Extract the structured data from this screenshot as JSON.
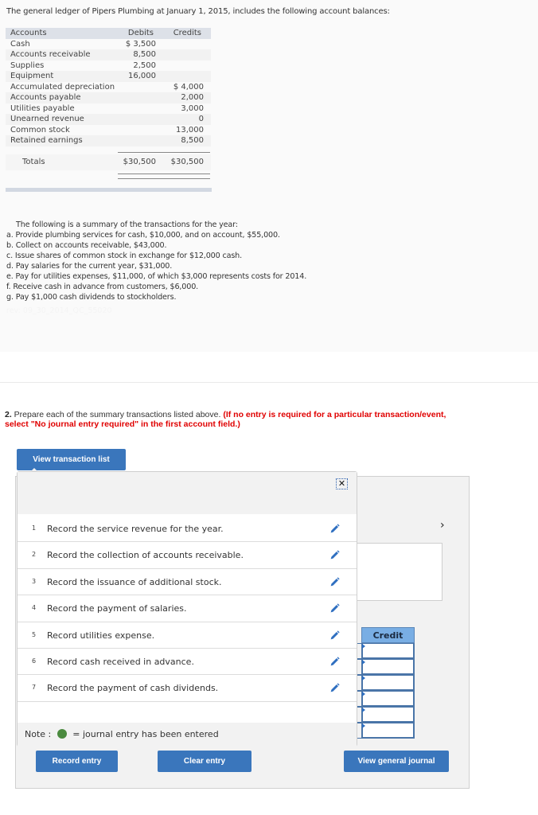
{
  "intro": "The general ledger of Pipers Plumbing at January 1, 2015, includes the following account balances:",
  "ledger": {
    "headers": {
      "account": "Accounts",
      "debits": "Debits",
      "credits": "Credits"
    },
    "rows": [
      {
        "account": "Cash",
        "debit": "$ 3,500",
        "credit": ""
      },
      {
        "account": "Accounts receivable",
        "debit": "8,500",
        "credit": ""
      },
      {
        "account": "Supplies",
        "debit": "2,500",
        "credit": ""
      },
      {
        "account": "Equipment",
        "debit": "16,000",
        "credit": ""
      },
      {
        "account": "Accumulated depreciation",
        "debit": "",
        "credit": "$ 4,000"
      },
      {
        "account": "Accounts payable",
        "debit": "",
        "credit": "2,000"
      },
      {
        "account": "Utilities payable",
        "debit": "",
        "credit": "3,000"
      },
      {
        "account": "Unearned revenue",
        "debit": "",
        "credit": "0"
      },
      {
        "account": "Common stock",
        "debit": "",
        "credit": "13,000"
      },
      {
        "account": "Retained earnings",
        "debit": "",
        "credit": "8,500"
      }
    ],
    "totals": {
      "label": "Totals",
      "debit": "$30,500",
      "credit": "$30,500"
    }
  },
  "summary": {
    "lead": "The following is a summary of the transactions for the year:",
    "items": [
      "a. Provide plumbing services for cash, $10,000, and on account, $55,000.",
      "b. Collect on accounts receivable, $43,000.",
      "c. Issue shares of common stock in exchange for $12,000 cash.",
      "d. Pay salaries for the current year, $31,000.",
      "e. Pay for utilities expenses, $11,000, of which $3,000 represents costs for 2014.",
      "f.  Receive cash in advance from customers, $6,000.",
      "g. Pay $1,000 cash dividends to stockholders."
    ],
    "revision": "rev: 09_30_2014_QC_55020"
  },
  "question": {
    "number": "2.",
    "text": " Prepare each of the summary transactions listed above. ",
    "instruction": "(If no entry is required for a particular transaction/event, select \"No journal entry required\" in the first account field.)"
  },
  "buttons": {
    "view_transaction_list": "View transaction list",
    "record_entry": "Record entry",
    "clear_entry": "Clear entry",
    "view_general_journal": "View general journal"
  },
  "popup": {
    "close_symbol": "✕",
    "transactions": [
      {
        "num": "1",
        "label": "Record the service revenue for the year."
      },
      {
        "num": "2",
        "label": "Record the collection of accounts receivable."
      },
      {
        "num": "3",
        "label": "Record the issuance of additional stock."
      },
      {
        "num": "4",
        "label": "Record the payment of salaries."
      },
      {
        "num": "5",
        "label": "Record utilities expense."
      },
      {
        "num": "6",
        "label": "Record cash received in advance."
      },
      {
        "num": "7",
        "label": "Record the payment of cash dividends."
      }
    ],
    "note_prefix": "Note :",
    "note_suffix": "= journal entry has been entered"
  },
  "journal": {
    "credit_header": "Credit",
    "next_symbol": "›"
  },
  "colors": {
    "button_blue": "#3a76bc",
    "instruction_red": "#e00000",
    "entered_dot_green": "#4a8a3e",
    "credit_header_blue": "#79aee4"
  }
}
